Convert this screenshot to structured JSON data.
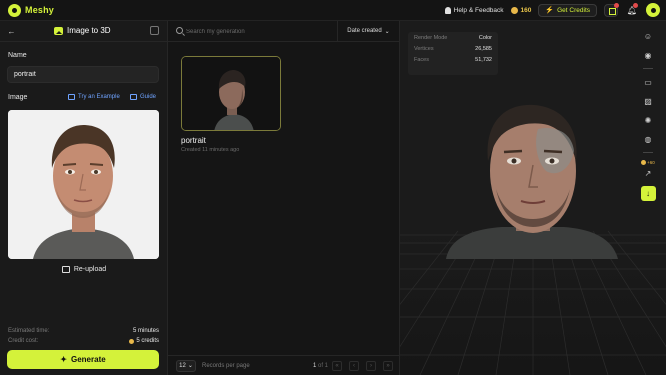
{
  "header": {
    "brand": "Meshy",
    "help_label": "Help & Feedback",
    "credits": "160",
    "get_credits_label": "Get Credits"
  },
  "left_panel": {
    "title": "Image to 3D",
    "name_label": "Name",
    "name_value": "portrait",
    "image_label": "Image",
    "try_example_label": "Try an Example",
    "guide_label": "Guide",
    "reupload_label": "Re-upload",
    "estimated_time_label": "Estimated time:",
    "estimated_time_value": "5 minutes",
    "credit_cost_label": "Credit cost:",
    "credit_cost_value": "5 credits",
    "generate_label": "Generate"
  },
  "generations": {
    "search_placeholder": "Search my generation",
    "sort_label": "Date created",
    "items": [
      {
        "title": "portrait",
        "created": "Created 11 minutes ago"
      }
    ],
    "per_page": "12",
    "per_page_label": "Records per page",
    "page_current": "1",
    "page_total": "of 1"
  },
  "viewer": {
    "render_mode_label": "Render Mode",
    "render_mode_value": "Color",
    "vertices_label": "Vertices",
    "vertices_value": "26,585",
    "faces_label": "Faces",
    "faces_value": "51,732",
    "toolbar_credit": "+60"
  },
  "colors": {
    "accent": "#d4f23a",
    "background": "#121212",
    "panel": "#1a1a1a",
    "link": "#6fa3ff",
    "coin": "#e8b84a"
  }
}
